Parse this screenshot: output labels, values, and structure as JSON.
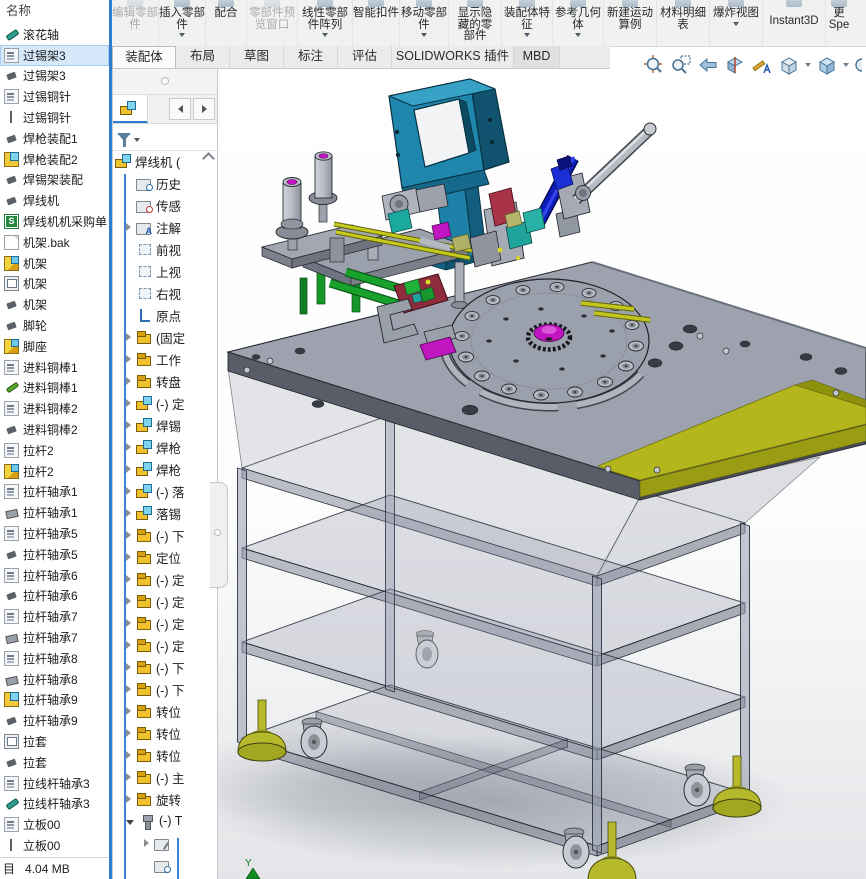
{
  "ribbon": {
    "buttons": [
      {
        "label": "编辑零部件",
        "enabled": false,
        "dropdown": false
      },
      {
        "label": "插入零部件",
        "enabled": true,
        "dropdown": true
      },
      {
        "label": "配合",
        "enabled": true,
        "dropdown": false
      },
      {
        "label": "零部件预览窗口",
        "enabled": false,
        "dropdown": false
      },
      {
        "label": "线性零部件阵列",
        "enabled": true,
        "dropdown": true
      },
      {
        "label": "智能扣件",
        "enabled": true,
        "dropdown": false
      },
      {
        "label": "移动零部件",
        "enabled": true,
        "dropdown": true
      },
      {
        "label": "显示隐藏的零部件",
        "enabled": true,
        "dropdown": false
      },
      {
        "label": "装配体特征",
        "enabled": true,
        "dropdown": true
      },
      {
        "label": "参考几何体",
        "enabled": true,
        "dropdown": true
      },
      {
        "label": "新建运动算例",
        "enabled": true,
        "dropdown": false
      },
      {
        "label": "材料明细表",
        "enabled": true,
        "dropdown": false
      },
      {
        "label": "爆炸视图",
        "enabled": true,
        "dropdown": true
      },
      {
        "label": "Instant3D",
        "enabled": true,
        "dropdown": false
      },
      {
        "line1": "更",
        "line2": "Spe",
        "enabled": true,
        "dropdown": false
      }
    ]
  },
  "tabs": {
    "items": [
      {
        "label": "装配体",
        "active": true
      },
      {
        "label": "布局",
        "active": false
      },
      {
        "label": "草图",
        "active": false
      },
      {
        "label": "标注",
        "active": false
      },
      {
        "label": "评估",
        "active": false
      },
      {
        "label": "SOLIDWORKS 插件",
        "active": false
      },
      {
        "label": "MBD",
        "active": false
      }
    ]
  },
  "headsup": {
    "icons": [
      "zoom-to-fit",
      "zoom-to-area",
      "previous-view",
      "section-view",
      "view-settings",
      "view-orientation",
      "display-style"
    ]
  },
  "file_panel": {
    "header": "名称",
    "status_label": "目",
    "size": "4.04 MB",
    "items": [
      {
        "label": "滚花轴",
        "icon": "part-teal",
        "state": ""
      },
      {
        "label": "过锡架3",
        "icon": "dwg",
        "state": "selected"
      },
      {
        "label": "过锡架3",
        "icon": "part-dark",
        "state": ""
      },
      {
        "label": "过锡铜针",
        "icon": "dwg",
        "state": ""
      },
      {
        "label": "过锡铜针",
        "icon": "pin",
        "state": ""
      },
      {
        "label": "焊枪装配1",
        "icon": "part-dark",
        "state": ""
      },
      {
        "label": "焊枪装配2",
        "icon": "asm-color",
        "state": ""
      },
      {
        "label": "焊锡架装配",
        "icon": "part-dark",
        "state": ""
      },
      {
        "label": "焊线机",
        "icon": "part-dark",
        "state": ""
      },
      {
        "label": "焊线机机采购单",
        "icon": "excel-s",
        "state": ""
      },
      {
        "label": "机架.bak",
        "icon": "page",
        "state": ""
      },
      {
        "label": "机架",
        "icon": "part-color",
        "state": ""
      },
      {
        "label": "机架",
        "icon": "dwg2",
        "state": ""
      },
      {
        "label": "机架",
        "icon": "part-dark",
        "state": ""
      },
      {
        "label": "脚轮",
        "icon": "part-dark",
        "state": ""
      },
      {
        "label": "脚座",
        "icon": "part-color",
        "state": ""
      },
      {
        "label": "进料铜棒1",
        "icon": "dwg",
        "state": ""
      },
      {
        "label": "进料铜棒1",
        "icon": "part-green",
        "state": ""
      },
      {
        "label": "进料铜棒2",
        "icon": "dwg",
        "state": ""
      },
      {
        "label": "进料铜棒2",
        "icon": "part-dark",
        "state": ""
      },
      {
        "label": "拉杆2",
        "icon": "dwg",
        "state": ""
      },
      {
        "label": "拉杆2",
        "icon": "part-color",
        "state": ""
      },
      {
        "label": "拉杆轴承1",
        "icon": "dwg",
        "state": ""
      },
      {
        "label": "拉杆轴承1",
        "icon": "part-gray",
        "state": ""
      },
      {
        "label": "拉杆轴承5",
        "icon": "dwg",
        "state": ""
      },
      {
        "label": "拉杆轴承5",
        "icon": "part-dark",
        "state": ""
      },
      {
        "label": "拉杆轴承6",
        "icon": "dwg",
        "state": ""
      },
      {
        "label": "拉杆轴承6",
        "icon": "part-dark",
        "state": ""
      },
      {
        "label": "拉杆轴承7",
        "icon": "dwg",
        "state": ""
      },
      {
        "label": "拉杆轴承7",
        "icon": "part-gray",
        "state": ""
      },
      {
        "label": "拉杆轴承8",
        "icon": "dwg",
        "state": ""
      },
      {
        "label": "拉杆轴承8",
        "icon": "part-gray",
        "state": ""
      },
      {
        "label": "拉杆轴承9",
        "icon": "asm-color",
        "state": ""
      },
      {
        "label": "拉杆轴承9",
        "icon": "part-dark",
        "state": ""
      },
      {
        "label": "拉套",
        "icon": "dwg2",
        "state": ""
      },
      {
        "label": "拉套",
        "icon": "part-dark",
        "state": ""
      },
      {
        "label": "拉线杆轴承3",
        "icon": "dwg",
        "state": ""
      },
      {
        "label": "拉线杆轴承3",
        "icon": "part-teal",
        "state": ""
      },
      {
        "label": "立板00",
        "icon": "dwg",
        "state": ""
      },
      {
        "label": "立板00",
        "icon": "pin",
        "state": ""
      }
    ]
  },
  "feature_panel": {
    "root_label": "焊线机 (",
    "items": [
      {
        "label": "历史",
        "icon": "folder-history",
        "arrow": "none",
        "indent": "i1"
      },
      {
        "label": "传感",
        "icon": "folder-sensor",
        "arrow": "none",
        "indent": "i1"
      },
      {
        "label": "注解",
        "icon": "folder-a",
        "arrow": "right",
        "indent": "i1"
      },
      {
        "label": "前视",
        "icon": "plane",
        "arrow": "none",
        "indent": "i1"
      },
      {
        "label": "上视",
        "icon": "plane",
        "arrow": "none",
        "indent": "i1"
      },
      {
        "label": "右视",
        "icon": "plane",
        "arrow": "none",
        "indent": "i1"
      },
      {
        "label": "原点",
        "icon": "origin",
        "arrow": "none",
        "indent": "i1"
      },
      {
        "label": "(固定",
        "icon": "part",
        "arrow": "right",
        "indent": "i1"
      },
      {
        "label": "工作",
        "icon": "part",
        "arrow": "right",
        "indent": "i1"
      },
      {
        "label": "转盘",
        "icon": "part",
        "arrow": "right",
        "indent": "i1"
      },
      {
        "label": "(-) 定",
        "icon": "asm",
        "arrow": "right",
        "indent": "i1"
      },
      {
        "label": "焊锡",
        "icon": "asm",
        "arrow": "right",
        "indent": "i1"
      },
      {
        "label": "焊枪",
        "icon": "asm",
        "arrow": "right",
        "indent": "i1"
      },
      {
        "label": "焊枪",
        "icon": "asm",
        "arrow": "right",
        "indent": "i1"
      },
      {
        "label": "(-) 落",
        "icon": "asm",
        "arrow": "right",
        "indent": "i1"
      },
      {
        "label": "落锡",
        "icon": "asm",
        "arrow": "right",
        "indent": "i1"
      },
      {
        "label": "(-) 下",
        "icon": "part",
        "arrow": "right",
        "indent": "i1"
      },
      {
        "label": "定位",
        "icon": "part",
        "arrow": "right",
        "indent": "i1"
      },
      {
        "label": "(-) 定",
        "icon": "part",
        "arrow": "right",
        "indent": "i1"
      },
      {
        "label": "(-) 定",
        "icon": "part",
        "arrow": "right",
        "indent": "i1"
      },
      {
        "label": "(-) 定",
        "icon": "part",
        "arrow": "right",
        "indent": "i1"
      },
      {
        "label": "(-) 定",
        "icon": "part",
        "arrow": "right",
        "indent": "i1"
      },
      {
        "label": "(-) 下",
        "icon": "part",
        "arrow": "right",
        "indent": "i1"
      },
      {
        "label": "(-) 下",
        "icon": "part",
        "arrow": "right",
        "indent": "i1"
      },
      {
        "label": "转位",
        "icon": "part",
        "arrow": "right",
        "indent": "i1"
      },
      {
        "label": "转位",
        "icon": "part",
        "arrow": "right",
        "indent": "i1"
      },
      {
        "label": "转位",
        "icon": "part",
        "arrow": "right",
        "indent": "i1"
      },
      {
        "label": "(-) 主",
        "icon": "part",
        "arrow": "right",
        "indent": "i1"
      },
      {
        "label": "旋转",
        "icon": "part",
        "arrow": "right",
        "indent": "i1"
      },
      {
        "label": "(-) T",
        "icon": "screw",
        "arrow": "down",
        "indent": "i1"
      },
      {
        "label": "",
        "icon": "folder-clip",
        "arrow": "right",
        "indent": "i2"
      },
      {
        "label": "",
        "icon": "folder-history",
        "arrow": "none",
        "indent": "i2"
      }
    ]
  },
  "viewport": {
    "origin_axis_label": "Y"
  },
  "colors": {
    "accent_border": "#2e7dd1",
    "selection": "#d6e9fb",
    "plate": "#9da2ae",
    "extension_plate": "#b4b71b",
    "tower": "#1f86ad",
    "feet": "#b6b92b",
    "viewport_bottom": "#e3e5e8"
  }
}
